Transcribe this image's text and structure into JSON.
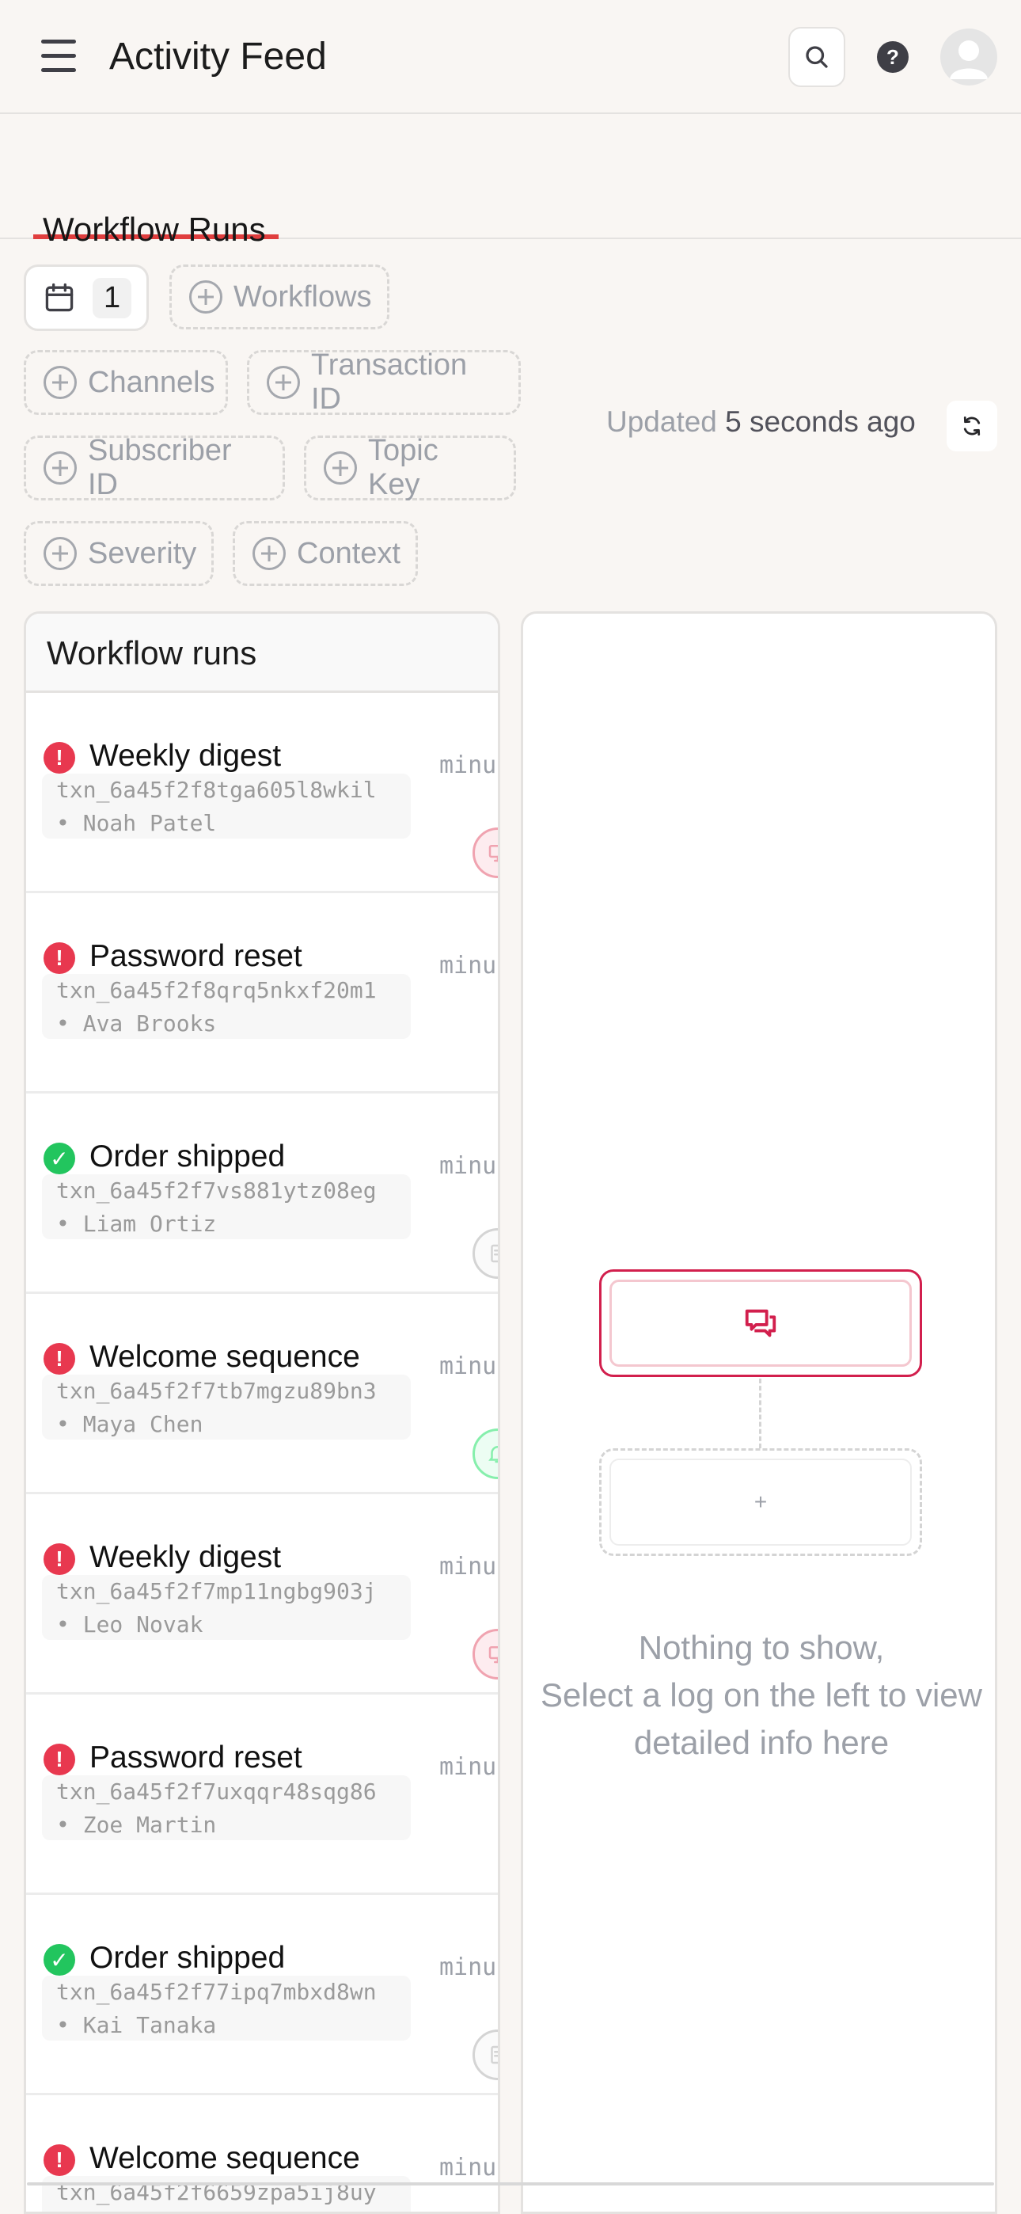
{
  "header": {
    "title": "Activity Feed",
    "menu_icon": "hamburger-menu-icon",
    "search_icon": "search-icon",
    "help_label": "?",
    "avatar_icon": "user-avatar-icon"
  },
  "tabs": [
    {
      "label": "Workflow Runs",
      "active": true
    }
  ],
  "filters": {
    "date_count": "1",
    "chips": [
      "Workflows",
      "Channels",
      "Transaction ID",
      "Subscriber ID",
      "Topic Key",
      "Severity",
      "Context"
    ]
  },
  "status_bar": {
    "updated_prefix": "Updated",
    "updated_value": "5 seconds ago",
    "refresh_icon": "refresh-icon"
  },
  "list": {
    "title": "Workflow runs",
    "rows": [
      {
        "status": "error",
        "status_glyph": "!",
        "workflow": "Weekly digest",
        "txn": "txn_6a45f2f8tga605l8wkil",
        "subscriber": "• Noah Patel",
        "time": "minu",
        "channel": "in-app",
        "channel_icon": "monitor-icon"
      },
      {
        "status": "error",
        "status_glyph": "!",
        "workflow": "Password reset",
        "txn": "txn_6a45f2f8qrq5nkxf20m1",
        "subscriber": "• Ava Brooks",
        "time": "minu",
        "channel": "",
        "channel_icon": ""
      },
      {
        "status": "success",
        "status_glyph": "✓",
        "workflow": "Order shipped",
        "txn": "txn_6a45f2f7vs881ytz08eg",
        "subscriber": "• Liam Ortiz",
        "time": "minu",
        "channel": "email",
        "channel_icon": "document-icon"
      },
      {
        "status": "error",
        "status_glyph": "!",
        "workflow": "Welcome sequence",
        "txn": "txn_6a45f2f7tb7mgzu89bn3",
        "subscriber": "• Maya Chen",
        "time": "minu",
        "channel": "push",
        "channel_icon": "bell-icon"
      },
      {
        "status": "error",
        "status_glyph": "!",
        "workflow": "Weekly digest",
        "txn": "txn_6a45f2f7mp11ngbg903j",
        "subscriber": "• Leo Novak",
        "time": "minu",
        "channel": "in-app",
        "channel_icon": "monitor-icon"
      },
      {
        "status": "error",
        "status_glyph": "!",
        "workflow": "Password reset",
        "txn": "txn_6a45f2f7uxqqr48sqg86",
        "subscriber": "• Zoe Martin",
        "time": "minu",
        "channel": "",
        "channel_icon": ""
      },
      {
        "status": "success",
        "status_glyph": "✓",
        "workflow": "Order shipped",
        "txn": "txn_6a45f2f77ipq7mbxd8wn",
        "subscriber": "• Kai Tanaka",
        "time": "minu",
        "channel": "email",
        "channel_icon": "document-icon"
      },
      {
        "status": "error",
        "status_glyph": "!",
        "workflow": "Welcome sequence",
        "txn": "txn_6a45f2f6659zpa5ij8uy",
        "subscriber": "",
        "time": "minu",
        "channel": "",
        "channel_icon": ""
      }
    ]
  },
  "detail": {
    "step_icon": "chat-icon",
    "add_step_label": "+",
    "empty_line1": "Nothing to show,",
    "empty_line2": "Select a log on the left to view detailed info here"
  },
  "colors": {
    "accent": "#e03e3e",
    "error": "#e8384f",
    "success": "#22c55e",
    "step_border": "#d21f4d",
    "background": "#f9f6f3"
  }
}
